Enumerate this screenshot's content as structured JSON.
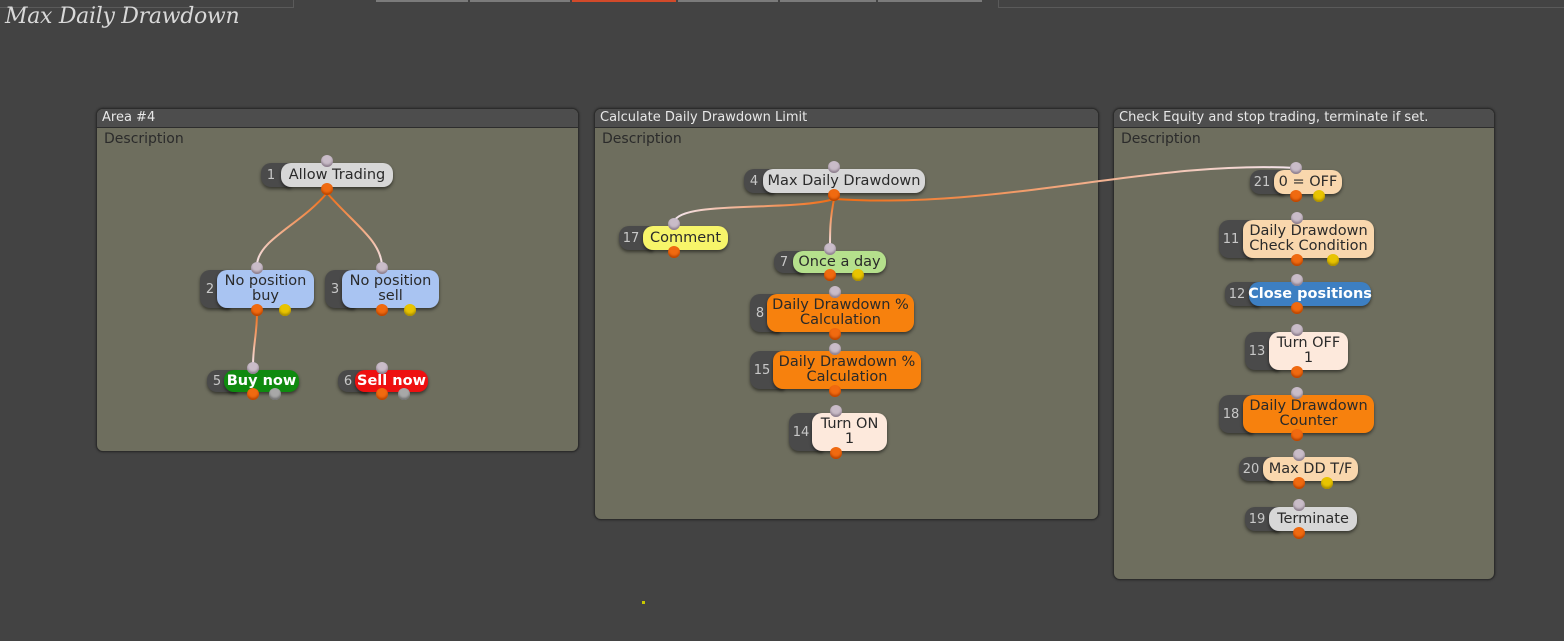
{
  "page": {
    "title": "Max Daily Drawdown"
  },
  "areas": [
    {
      "header": "Area #4",
      "description": "Description"
    },
    {
      "header": "Calculate Daily Drawdown Limit",
      "description": "Description"
    },
    {
      "header": "Check Equity and stop trading, terminate if set.",
      "description": "Description"
    }
  ],
  "blocks": {
    "b1": {
      "num": "1",
      "line1": "Allow Trading",
      "line2": ""
    },
    "b2": {
      "num": "2",
      "line1": "No position",
      "line2": "buy"
    },
    "b3": {
      "num": "3",
      "line1": "No position",
      "line2": "sell"
    },
    "b5": {
      "num": "5",
      "line1": "Buy now",
      "line2": ""
    },
    "b6": {
      "num": "6",
      "line1": "Sell now",
      "line2": ""
    },
    "b4": {
      "num": "4",
      "line1": "Max Daily Drawdown",
      "line2": ""
    },
    "b17": {
      "num": "17",
      "line1": "Comment",
      "line2": ""
    },
    "b7": {
      "num": "7",
      "line1": "Once a day",
      "line2": ""
    },
    "b8": {
      "num": "8",
      "line1": "Daily Drawdown %",
      "line2": "Calculation"
    },
    "b15": {
      "num": "15",
      "line1": "Daily Drawdown %",
      "line2": "Calculation"
    },
    "b14": {
      "num": "14",
      "line1": "Turn ON",
      "line2": "1"
    },
    "b21": {
      "num": "21",
      "line1": "0 = OFF",
      "line2": ""
    },
    "b11": {
      "num": "11",
      "line1": "Daily Drawdown",
      "line2": "Check Condition"
    },
    "b12": {
      "num": "12",
      "line1": "Close positions",
      "line2": ""
    },
    "b13": {
      "num": "13",
      "line1": "Turn OFF",
      "line2": "1"
    },
    "b18": {
      "num": "18",
      "line1": "Daily Drawdown",
      "line2": "Counter"
    },
    "b20": {
      "num": "20",
      "line1": "Max DD T/F",
      "line2": ""
    },
    "b19": {
      "num": "19",
      "line1": "Terminate",
      "line2": ""
    }
  },
  "colors": {
    "canvas": "#434343",
    "area": "#6e6e5e",
    "wire_start": "#f06a10",
    "wire_end": "#f4e6ee"
  }
}
